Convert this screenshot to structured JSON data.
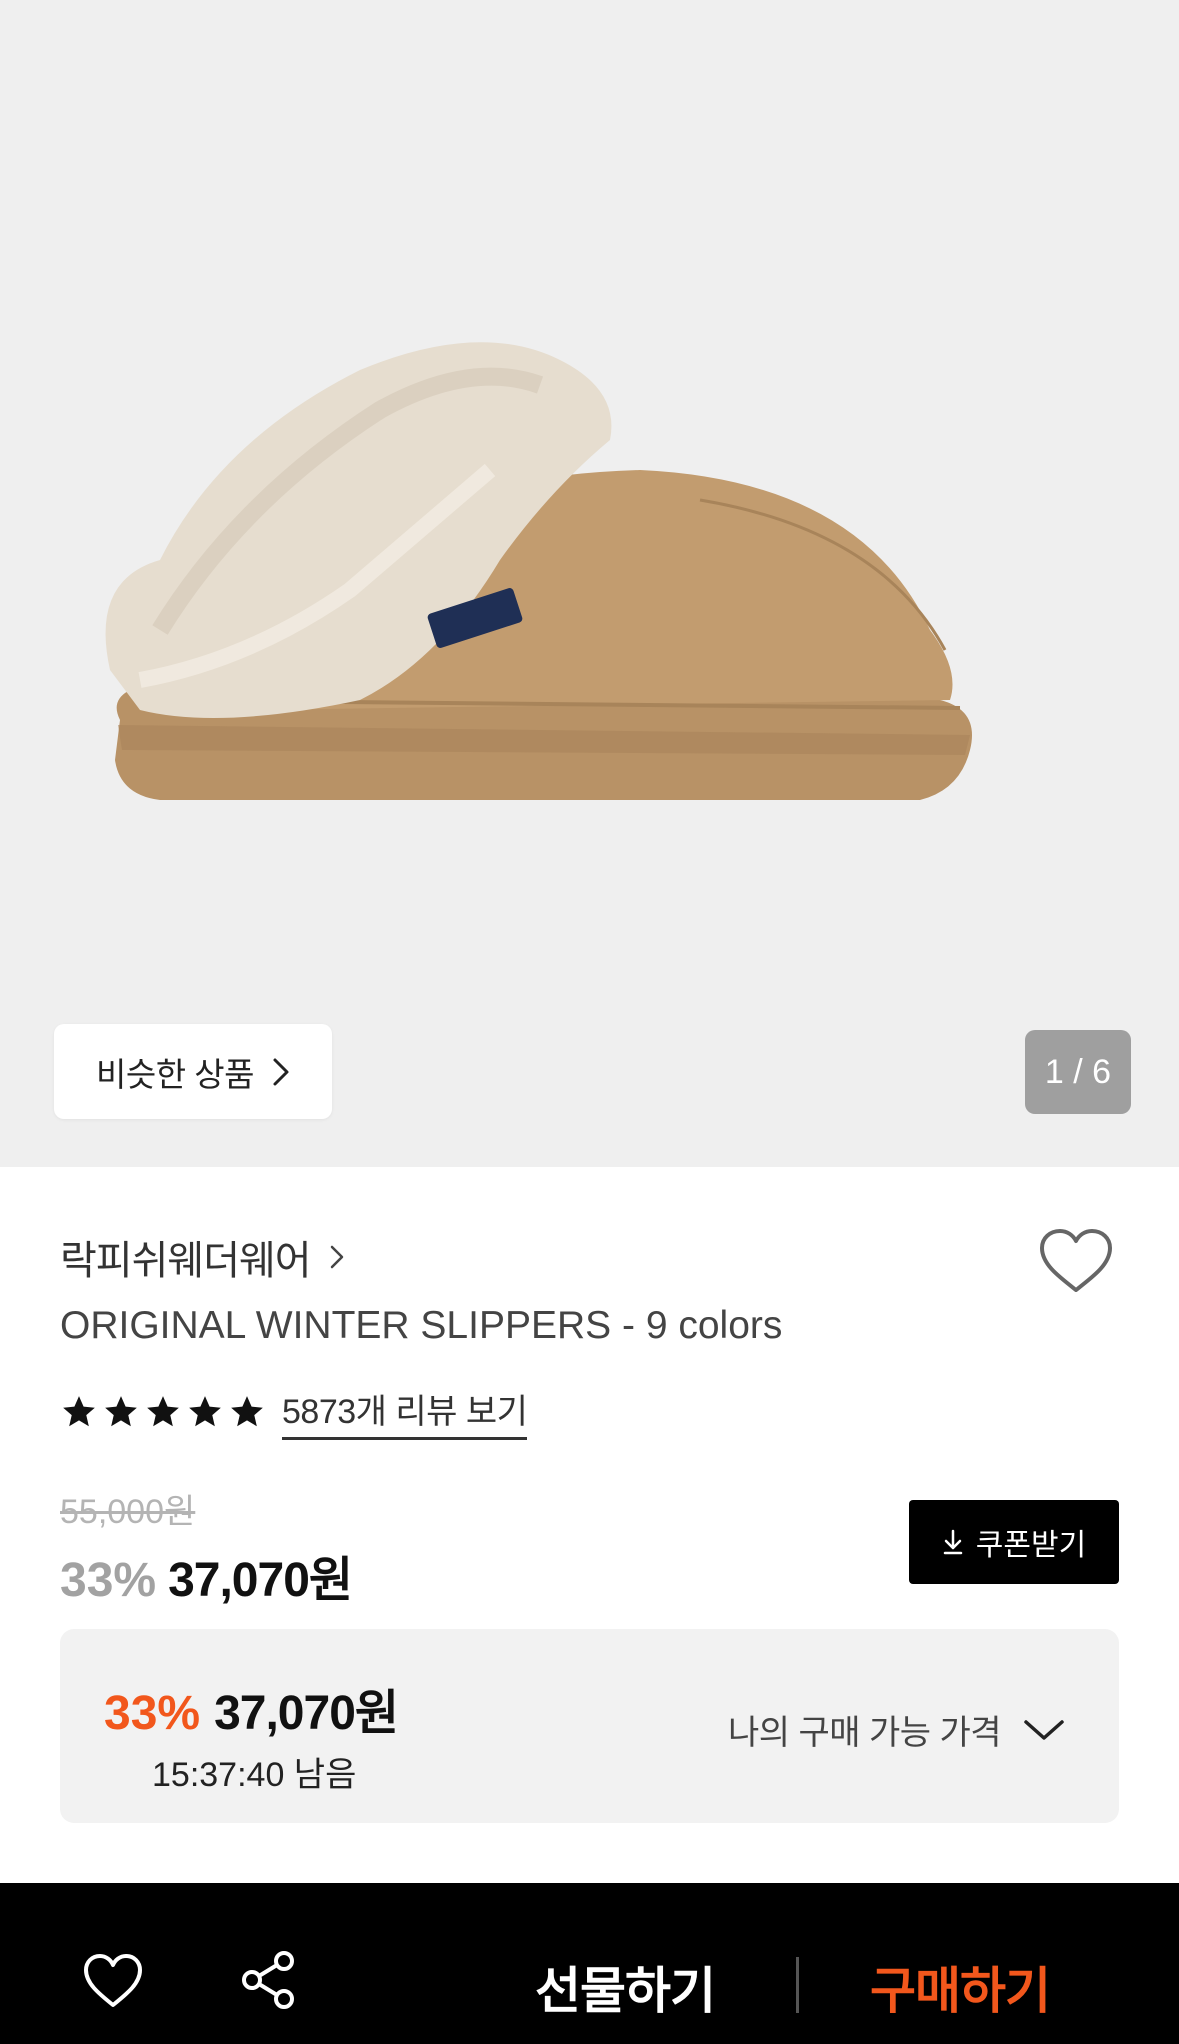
{
  "gallery": {
    "similar_label": "비슷한 상품",
    "counter": "1 / 6"
  },
  "product": {
    "brand": "락피쉬웨더웨어",
    "title": "ORIGINAL WINTER SLIPPERS - 9 colors",
    "rating_stars": 5,
    "review_link": "5873개 리뷰 보기",
    "original_price": "55,000원",
    "discount": "33%",
    "price": "37,070원",
    "coupon_label": "쿠폰받기"
  },
  "my_price": {
    "discount": "33%",
    "price": "37,070원",
    "countdown": "15:37:40 남음",
    "label": "나의 구매 가능 가격"
  },
  "bottom_bar": {
    "gift_label": "선물하기",
    "buy_label": "구매하기"
  },
  "colors": {
    "accent": "#f2571c",
    "gallery_bg": "#efefef",
    "box_bg": "#f2f2f2"
  },
  "icons": [
    "chevron-right-icon",
    "heart-outline-icon",
    "star-icon",
    "download-icon",
    "chevron-down-icon",
    "share-icon"
  ]
}
